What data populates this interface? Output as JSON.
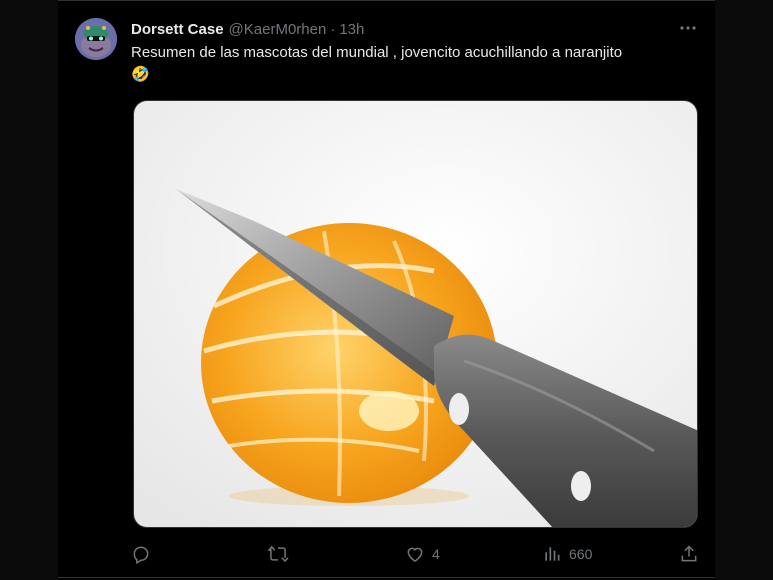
{
  "tweet": {
    "display_name": "Dorsett Case",
    "handle": "@KaerM0rhen",
    "separator": "·",
    "time": "13h",
    "text": "Resumen de las mascotas del mundial , jovencito acuchillando a naranjito",
    "emoji": "🤣",
    "image": {
      "description_icon": "orange-knife-photo"
    }
  },
  "actions": {
    "reply_count": "",
    "retweet_count": "",
    "like_count": "4",
    "views_count": "660"
  },
  "icons": {
    "more": "more-icon",
    "reply": "reply-icon",
    "retweet": "retweet-icon",
    "like": "heart-icon",
    "views": "views-icon",
    "share": "share-icon"
  },
  "colors": {
    "background": "#000000",
    "text": "#e7e9ea",
    "muted": "#71767b",
    "orange": "#f59a1a"
  }
}
